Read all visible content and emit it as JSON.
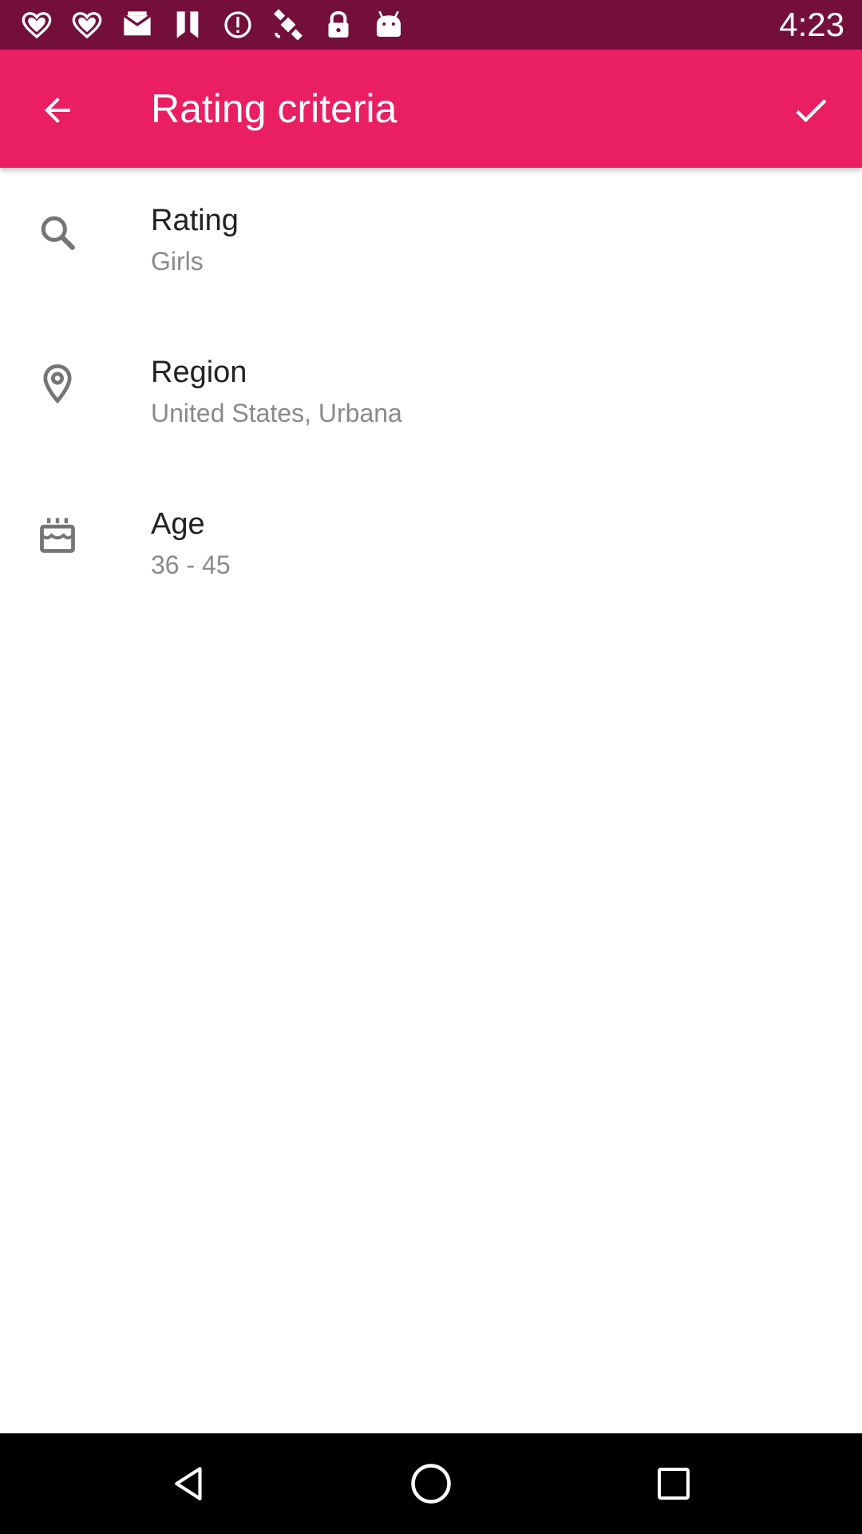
{
  "status_bar": {
    "time": "4:23",
    "icons": [
      "heart-icon",
      "heart-icon",
      "mail-icon",
      "bookmark-icon",
      "alert-icon",
      "satellite-fake-gps-icon",
      "lock-icon",
      "android-icon"
    ]
  },
  "app_bar": {
    "title": "Rating criteria",
    "back_icon": "arrow-back-icon",
    "confirm_icon": "check-icon",
    "color": "#e91e63"
  },
  "criteria": [
    {
      "icon": "search-icon",
      "title": "Rating",
      "value": "Girls"
    },
    {
      "icon": "location-pin-icon",
      "title": "Region",
      "value": "United States, Urbana"
    },
    {
      "icon": "cake-icon",
      "title": "Age",
      "value": "36 - 45"
    }
  ],
  "nav_bar": {
    "icons": [
      "back-triangle-icon",
      "home-circle-icon",
      "recents-square-icon"
    ]
  },
  "colors": {
    "status_bar": "#730f3a",
    "accent": "#e91e63",
    "primary_text": "#212121",
    "secondary_text": "#8a8a8a",
    "icon_gray": "#757575"
  }
}
